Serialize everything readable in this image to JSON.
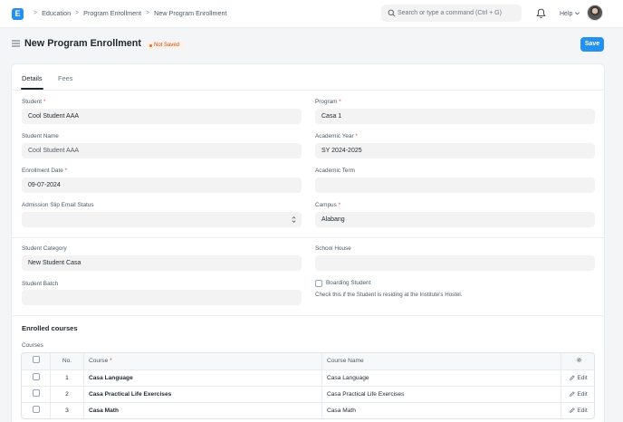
{
  "nav": {
    "logo_letter": "E",
    "breadcrumbs": [
      "Education",
      "Program Enrollment",
      "New Program Enrollment"
    ],
    "search_placeholder": "Search or type a command (Ctrl + G)",
    "help_label": "Help"
  },
  "page": {
    "title": "New Program Enrollment",
    "status": "Not Saved",
    "save_label": "Save"
  },
  "tabs": [
    "Details",
    "Fees"
  ],
  "form": {
    "student": {
      "label": "Student",
      "value": "Cool Student AAA"
    },
    "program": {
      "label": "Program",
      "value": "Casa 1"
    },
    "student_name": {
      "label": "Student Name",
      "value": "Cool Student AAA"
    },
    "academic_year": {
      "label": "Academic Year",
      "value": "SY 2024-2025"
    },
    "enrollment_date": {
      "label": "Enrollment Date",
      "value": "09-07-2024"
    },
    "academic_term": {
      "label": "Academic Term",
      "value": ""
    },
    "admission_slip_status": {
      "label": "Admission Slip Email Status",
      "value": ""
    },
    "campus": {
      "label": "Campus",
      "value": "Alabang"
    },
    "student_category": {
      "label": "Student Category",
      "value": "New Student Casa"
    },
    "school_house": {
      "label": "School House",
      "value": ""
    },
    "student_batch": {
      "label": "Student Batch",
      "value": ""
    },
    "boarding_student": {
      "label": "Boarding Student",
      "description": "Check this if the Student is residing at the Institute's Hostel."
    }
  },
  "courses_section": {
    "title": "Enrolled courses",
    "table_label": "Courses",
    "columns": {
      "no": "No.",
      "course": "Course",
      "course_name": "Course Name"
    },
    "edit_label": "Edit",
    "rows": [
      {
        "no": "1",
        "course": "Casa Language",
        "course_name": "Casa Language"
      },
      {
        "no": "2",
        "course": "Casa Practical Life Exercises",
        "course_name": "Casa Practical Life Exercises"
      },
      {
        "no": "3",
        "course": "Casa Math",
        "course_name": "Casa Math"
      }
    ]
  },
  "colors": {
    "accent": "#2490ef",
    "required": "#e24c4c",
    "not_saved": "#c4501b"
  }
}
